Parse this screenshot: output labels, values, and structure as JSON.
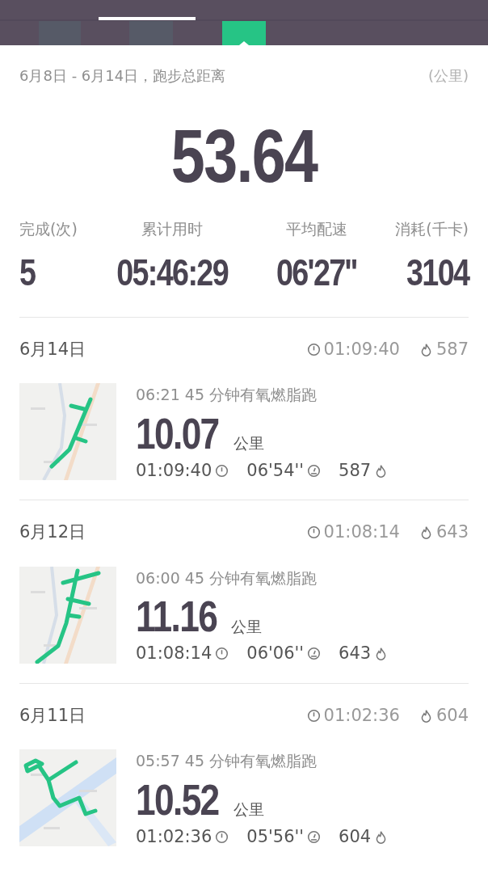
{
  "summary": {
    "range": "6月8日 - 6月14日，跑步总距离",
    "unit": "(公里)",
    "total": "53.64"
  },
  "stats": [
    {
      "label": "完成(次)",
      "value": "5"
    },
    {
      "label": "累计用时",
      "value": "05:46:29"
    },
    {
      "label": "平均配速",
      "value": "06'27''"
    },
    {
      "label": "消耗(千卡)",
      "value": "3104"
    }
  ],
  "runs": [
    {
      "date": "6月14日",
      "header_duration": "01:09:40",
      "header_calories": "587",
      "title": "06:21 45 分钟有氧燃脂跑",
      "distance": "10.07",
      "distance_unit": "公里",
      "duration": "01:09:40",
      "pace": "06'54''",
      "calories": "587"
    },
    {
      "date": "6月12日",
      "header_duration": "01:08:14",
      "header_calories": "643",
      "title": "06:00 45 分钟有氧燃脂跑",
      "distance": "11.16",
      "distance_unit": "公里",
      "duration": "01:08:14",
      "pace": "06'06''",
      "calories": "643"
    },
    {
      "date": "6月11日",
      "header_duration": "01:02:36",
      "header_calories": "604",
      "title": "05:57 45 分钟有氧燃脂跑",
      "distance": "10.52",
      "distance_unit": "公里",
      "duration": "01:02:36",
      "pace": "05'56''",
      "calories": "604"
    }
  ]
}
